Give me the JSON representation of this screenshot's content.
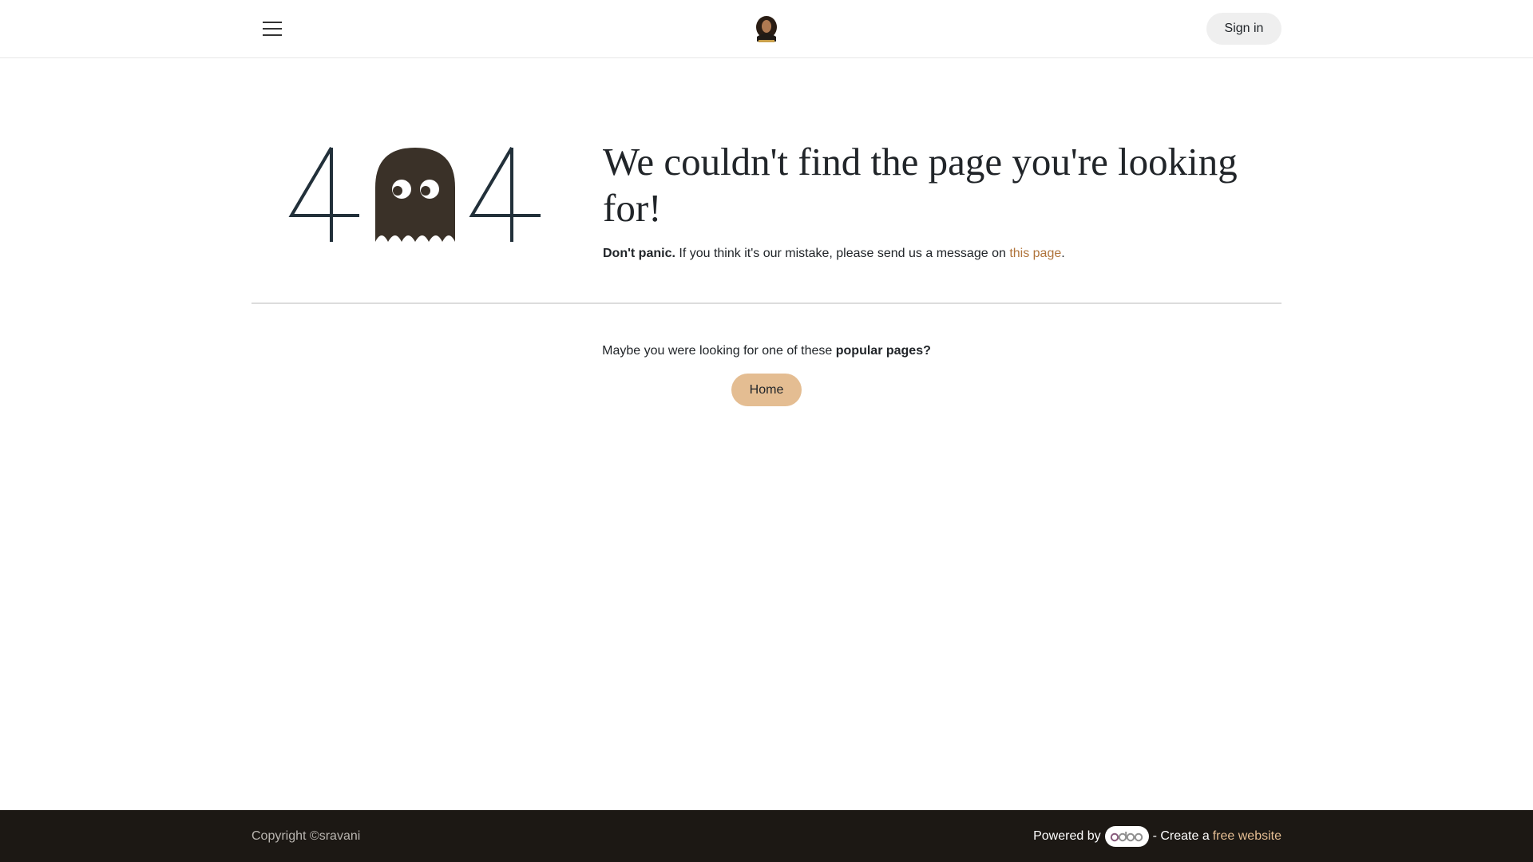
{
  "header": {
    "menu_icon": "hamburger-menu-icon",
    "logo_alt": "site-logo",
    "signin_label": "Sign in"
  },
  "error": {
    "digit_left": "4",
    "digit_right": "4",
    "ghost_icon": "ghost-icon",
    "headline": "We couldn't find the page you're looking for!",
    "message_bold": "Don't panic.",
    "message_text": " If you think it's our mistake, please send us a message on ",
    "message_link": "this page",
    "message_end": "."
  },
  "popular": {
    "text": "Maybe you were looking for one of these ",
    "bold": "popular pages?",
    "home_label": "Home"
  },
  "footer": {
    "copyright": "Copyright ©sravani",
    "powered_by": "Powered by ",
    "odoo_label": "odoo",
    "create_text": " - Create a",
    "free_website_link": "free website"
  },
  "colors": {
    "accent_link": "#b0743b",
    "home_button": "#e4bd92",
    "footer_bg": "#1c1814",
    "digit_color": "#22303a",
    "ghost_color": "#3a3128"
  }
}
